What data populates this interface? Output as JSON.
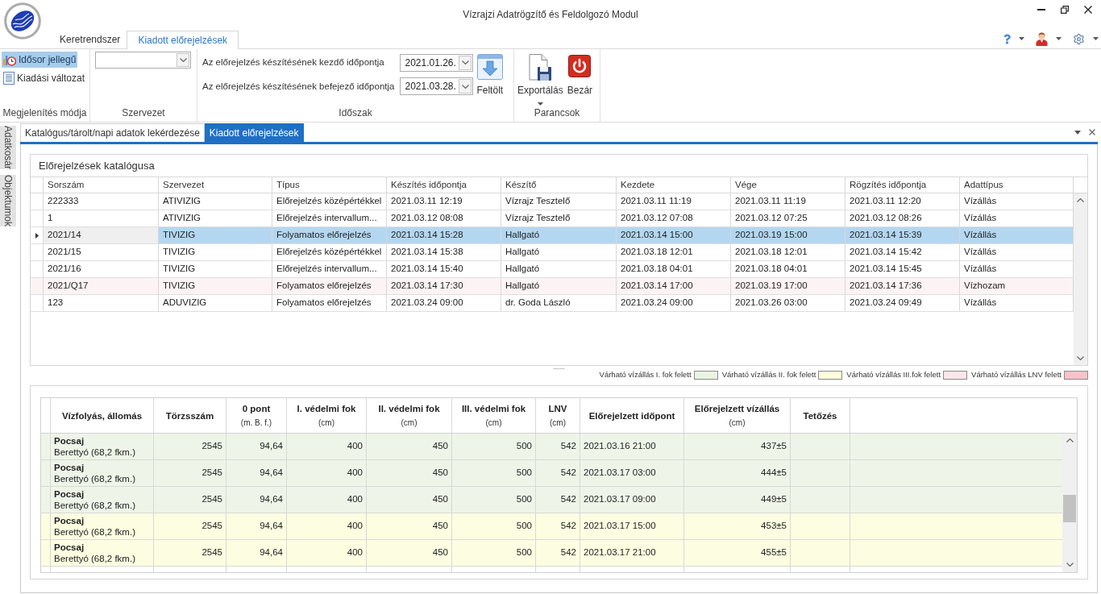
{
  "window": {
    "title": "Vízrajzi Adatrögzítő és Feldolgozó Modul"
  },
  "ribbon_tabs": [
    {
      "label": "Keretrendszer",
      "selected": false
    },
    {
      "label": "Kiadott előrejelzések",
      "selected": true
    }
  ],
  "display_mode": {
    "caption": "Megjelenítés módja",
    "options": [
      {
        "kind": "timeseries",
        "label": "Idősor jellegű",
        "selected": true
      },
      {
        "kind": "issue",
        "label": "Kiadási változat",
        "selected": false
      }
    ]
  },
  "organization": {
    "caption": "Szervezet"
  },
  "period": {
    "caption": "Időszak",
    "fields": [
      {
        "label": "Az előrejelzés készítésének kezdő időpontja",
        "value": "2021.01.26."
      },
      {
        "label": "Az előrejelzés készítésének befejező időpontja",
        "value": "2021.03.28."
      }
    ],
    "load_button": "Feltölt"
  },
  "commands": {
    "caption": "Parancsok",
    "buttons": [
      {
        "kind": "export",
        "label": "Exportálás"
      },
      {
        "kind": "close",
        "label": "Bezár"
      }
    ]
  },
  "side_tabs": [
    "Adatkosár",
    "Objektumok"
  ],
  "document_tabs": [
    {
      "label": "Katalógus/tárolt/napi adatok lekérdezése",
      "selected": false
    },
    {
      "label": "Kiadott előrejelzések",
      "selected": true
    }
  ],
  "catalog": {
    "title": "Előrejelzések katalógusa",
    "columns": [
      "Sorszám",
      "Szervezet",
      "Típus",
      "Készítés időpontja",
      "Készítő",
      "Kezdete",
      "Vége",
      "Rögzítés időpontja",
      "Adattípus"
    ],
    "rows": [
      {
        "cells": [
          "222333",
          "ATIVIZIG",
          "Előrejelzés középértékkel",
          "2021.03.11 12:19",
          "Vízrajz Tesztelő",
          "2021.03.11 11:19",
          "2021.03.11 11:19",
          "2021.03.11 12:20",
          "Vízállás"
        ],
        "selected": false,
        "color": "#ffffff"
      },
      {
        "cells": [
          "1",
          "ATIVIZIG",
          "Előrejelzés intervallum...",
          "2021.03.12 08:08",
          "Vízrajz Tesztelő",
          "2021.03.12 07:08",
          "2021.03.12 07:25",
          "2021.03.12 08:26",
          "Vízállás"
        ],
        "selected": false,
        "color": "#ffffff"
      },
      {
        "cells": [
          "2021/14",
          "TIVIZIG",
          "Folyamatos előrejelzés",
          "2021.03.14 15:28",
          "Hallgató",
          "2021.03.14 15:00",
          "2021.03.19 15:00",
          "2021.03.14 15:39",
          "Vízállás"
        ],
        "selected": true,
        "color": "#ffffff"
      },
      {
        "cells": [
          "2021/15",
          "TIVIZIG",
          "Előrejelzés középértékkel",
          "2021.03.14 15:38",
          "Hallgató",
          "2021.03.18 12:01",
          "2021.03.18 12:01",
          "2021.03.14 15:42",
          "Vízállás"
        ],
        "selected": false,
        "color": "#ffffff"
      },
      {
        "cells": [
          "2021/16",
          "TIVIZIG",
          "Előrejelzés intervallum...",
          "2021.03.14 15:40",
          "Hallgató",
          "2021.03.18 04:01",
          "2021.03.18 04:01",
          "2021.03.14 15:45",
          "Vízállás"
        ],
        "selected": false,
        "color": "#ffffff"
      },
      {
        "cells": [
          "2021/Q17",
          "TIVIZIG",
          "Folyamatos előrejelzés",
          "2021.03.14 17:30",
          "Hallgató",
          "2021.03.14 17:00",
          "2021.03.19 17:00",
          "2021.03.14 17:36",
          "Vízhozam"
        ],
        "selected": false,
        "color": "#fcf4f4"
      },
      {
        "cells": [
          "123",
          "ADUVIZIG",
          "Folyamatos előrejelzés",
          "2021.03.24 09:00",
          "dr. Goda László",
          "2021.03.24 09:00",
          "2021.03.26 03:00",
          "2021.03.24 09:49",
          "Vízállás"
        ],
        "selected": false,
        "color": "#ffffff"
      }
    ]
  },
  "legend": [
    {
      "label": "Várható vízállás I. fok felett",
      "color": "#eaf3e1"
    },
    {
      "label": "Várható vízállás II. fok felett",
      "color": "#fdfcdc"
    },
    {
      "label": "Várható vízállás III.fok felett",
      "color": "#fde6e9"
    },
    {
      "label": "Várható vízállás LNV felett",
      "color": "#f8c3c8"
    }
  ],
  "forecast_table": {
    "columns": [
      {
        "title": "Vízfolyás, állomás"
      },
      {
        "title": "Törzsszám"
      },
      {
        "title": "0 pont",
        "unit": "(m. B. f.)"
      },
      {
        "title": "I. védelmi fok",
        "unit": "(cm)"
      },
      {
        "title": "II. védelmi fok",
        "unit": "(cm)"
      },
      {
        "title": "III. védelmi fok",
        "unit": "(cm)"
      },
      {
        "title": "LNV",
        "unit": "(cm)"
      },
      {
        "title": "Előrejelzett időpont"
      },
      {
        "title": "Előrejelzett vízállás",
        "unit": "(cm)"
      },
      {
        "title": "Tetőzés"
      }
    ],
    "rows": [
      {
        "cells": [
          [
            "Pocsaj",
            "Berettyó (68,2 fkm.)"
          ],
          "2545",
          "94,64",
          "400",
          "450",
          "500",
          "542",
          "2021.03.16 21:00",
          "437±5"
        ],
        "color": "#eef5e8"
      },
      {
        "cells": [
          [
            "Pocsaj",
            "Berettyó (68,2 fkm.)"
          ],
          "2545",
          "94,64",
          "400",
          "450",
          "500",
          "542",
          "2021.03.17 03:00",
          "444±5"
        ],
        "color": "#eef5e8"
      },
      {
        "cells": [
          [
            "Pocsaj",
            "Berettyó (68,2 fkm.)"
          ],
          "2545",
          "94,64",
          "400",
          "450",
          "500",
          "542",
          "2021.03.17 09:00",
          "449±5"
        ],
        "color": "#eef5e8"
      },
      {
        "cells": [
          [
            "Pocsaj",
            "Berettyó (68,2 fkm.)"
          ],
          "2545",
          "94,64",
          "400",
          "450",
          "500",
          "542",
          "2021.03.17 15:00",
          "453±5"
        ],
        "color": "#fdfde1"
      },
      {
        "cells": [
          [
            "Pocsaj",
            "Berettyó (68,2 fkm.)"
          ],
          "2545",
          "94,64",
          "400",
          "450",
          "500",
          "542",
          "2021.03.17 21:00",
          "455±5"
        ],
        "color": "#fdfde1"
      }
    ]
  }
}
